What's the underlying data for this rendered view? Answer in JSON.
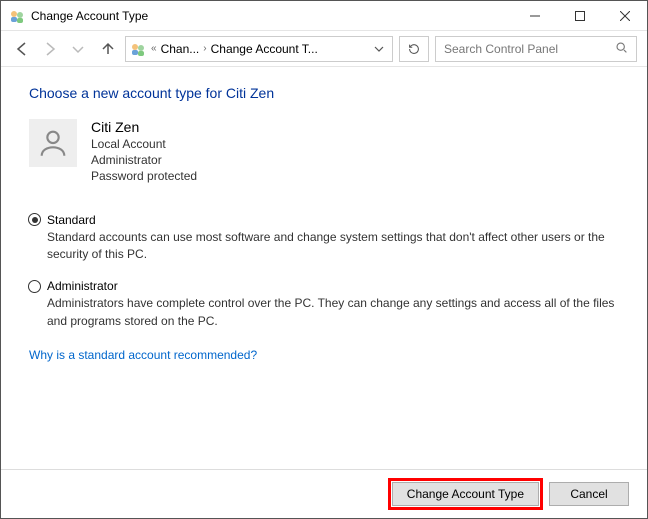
{
  "window": {
    "title": "Change Account Type"
  },
  "breadcrumbs": {
    "sep1": "«",
    "item1": "Chan...",
    "sep2": "›",
    "item2": "Change Account T..."
  },
  "search": {
    "placeholder": "Search Control Panel"
  },
  "page": {
    "heading": "Choose a new account type for Citi Zen"
  },
  "account": {
    "name": "Citi Zen",
    "type": "Local Account",
    "role": "Administrator",
    "password": "Password protected"
  },
  "options": {
    "standard": {
      "label": "Standard",
      "desc": "Standard accounts can use most software and change system settings that don't affect other users or the security of this PC."
    },
    "admin": {
      "label": "Administrator",
      "desc": "Administrators have complete control over the PC. They can change any settings and access all of the files and programs stored on the PC."
    }
  },
  "help": {
    "why_link": "Why is a standard account recommended?"
  },
  "buttons": {
    "change": "Change Account Type",
    "cancel": "Cancel"
  }
}
